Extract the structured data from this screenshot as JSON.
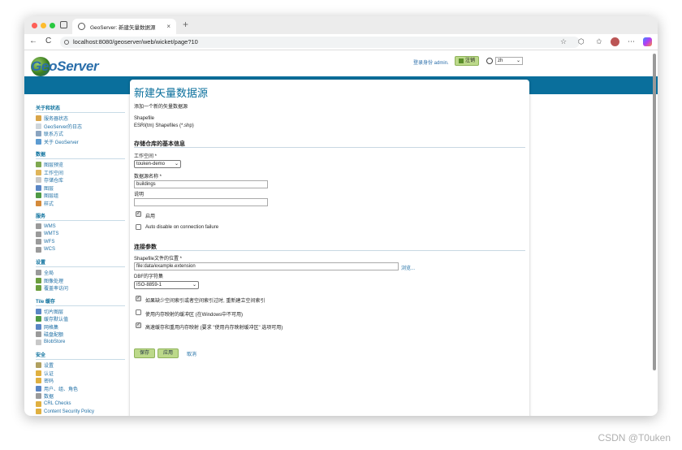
{
  "browser": {
    "tab_title": "GeoServer: 新建矢量数据源",
    "tab_close": "×",
    "new_tab": "+",
    "back": "←",
    "reload": "C",
    "url": "localhost:8080/geoserver/web/wicket/page?10",
    "bookmark": "☆",
    "extension": "⬡",
    "favorites": "✩",
    "more": "⋯"
  },
  "header": {
    "logo_text": "GeoServer",
    "login_text": "登录身份 admin.",
    "logout_label": "注销",
    "language": "zh",
    "language_chevron": "⌄"
  },
  "nav": {
    "sections": [
      {
        "title": "关于和状态",
        "items": [
          {
            "label": "服务器状态",
            "icon": "server-status-icon",
            "color": "#d9a54a"
          },
          {
            "label": "GeoServer的日志",
            "icon": "log-icon",
            "color": "#cfd6dc"
          },
          {
            "label": "联系方式",
            "icon": "contact-icon",
            "color": "#8aa4c0"
          },
          {
            "label": "关于 GeoServer",
            "icon": "about-icon",
            "color": "#5c9bd1"
          }
        ]
      },
      {
        "title": "数据",
        "items": [
          {
            "label": "图层预览",
            "icon": "layer-preview-icon",
            "color": "#7ea84f"
          },
          {
            "label": "工作空间",
            "icon": "workspace-icon",
            "color": "#e0b55a"
          },
          {
            "label": "存储仓库",
            "icon": "store-icon",
            "color": "#c8c8c8"
          },
          {
            "label": "图层",
            "icon": "layers-icon",
            "color": "#5a86c5"
          },
          {
            "label": "图层组",
            "icon": "layer-group-icon",
            "color": "#4f9a45"
          },
          {
            "label": "样式",
            "icon": "styles-icon",
            "color": "#d48a3a"
          }
        ]
      },
      {
        "title": "服务",
        "items": [
          {
            "label": "WMS",
            "icon": "wms-icon",
            "color": "#9a9a9a"
          },
          {
            "label": "WMTS",
            "icon": "wmts-icon",
            "color": "#9a9a9a"
          },
          {
            "label": "WFS",
            "icon": "wfs-icon",
            "color": "#9a9a9a"
          },
          {
            "label": "WCS",
            "icon": "wcs-icon",
            "color": "#9a9a9a"
          }
        ]
      },
      {
        "title": "设置",
        "items": [
          {
            "label": "全局",
            "icon": "global-icon",
            "color": "#9a9a9a"
          },
          {
            "label": "图像处理",
            "icon": "image-processing-icon",
            "color": "#6b9e3e"
          },
          {
            "label": "覆盖率访问",
            "icon": "coverage-access-icon",
            "color": "#6b9e3e"
          }
        ]
      },
      {
        "title": "Tile 缓存",
        "items": [
          {
            "label": "切片图层",
            "icon": "tile-layers-icon",
            "color": "#5a86c5"
          },
          {
            "label": "缓存默认值",
            "icon": "caching-defaults-icon",
            "color": "#4f9a45"
          },
          {
            "label": "网格集",
            "icon": "gridsets-icon",
            "color": "#5a86c5"
          },
          {
            "label": "磁盘配额",
            "icon": "disk-quota-icon",
            "color": "#9a9a9a"
          },
          {
            "label": "BlobStore",
            "icon": "blobstore-icon",
            "color": "#c8c8c8"
          }
        ]
      },
      {
        "title": "安全",
        "items": [
          {
            "label": "设置",
            "icon": "key-icon",
            "color": "#b0a060"
          },
          {
            "label": "认证",
            "icon": "auth-icon",
            "color": "#e0b040"
          },
          {
            "label": "密码",
            "icon": "lock-icon",
            "color": "#e0b040"
          },
          {
            "label": "用户、组、角色",
            "icon": "users-icon",
            "color": "#5a86c5"
          },
          {
            "label": "数据",
            "icon": "data-security-icon",
            "color": "#9a9a9a"
          },
          {
            "label": "CRL Checks",
            "icon": "crl-icon",
            "color": "#e0b040"
          },
          {
            "label": "Content Security Policy",
            "icon": "csp-icon",
            "color": "#e0b040"
          }
        ]
      }
    ]
  },
  "form": {
    "title": "新建矢量数据源",
    "subtitle": "添加一个新的矢量数据源",
    "store_type": "Shapefile",
    "store_desc": "ESRI(tm) Shapefiles (*.shp)",
    "basic_heading": "存储仓库的基本信息",
    "workspace_label": "工作空间 *",
    "workspace_value": "touken-demo",
    "datasource_label": "数据源名称 *",
    "datasource_value": "buildings",
    "description_label": "说明",
    "description_value": "",
    "enabled_label": "启用",
    "auto_disable_label": "Auto disable on connection failure",
    "params_heading": "连接参数",
    "shapefile_label": "Shapefile文件的位置 *",
    "shapefile_value": "file:data/example.extension",
    "browse_label": "浏览...",
    "charset_label": "DBF的字符集",
    "charset_value": "ISO-8859-1",
    "opt1_label": "如果缺少空间索引或者空间索引过时, 重新建立空间索引",
    "opt2_label": "使用内存映射的缓冲区 (在Windows中不可用)",
    "opt3_label": "高速缓存和重用内存映射 (要求 \"使用内存映射缓冲区\" 选项可用)",
    "save_label": "保存",
    "apply_label": "应用",
    "cancel_label": "取消",
    "checkmark": "✓"
  },
  "watermark": "CSDN @T0uken"
}
